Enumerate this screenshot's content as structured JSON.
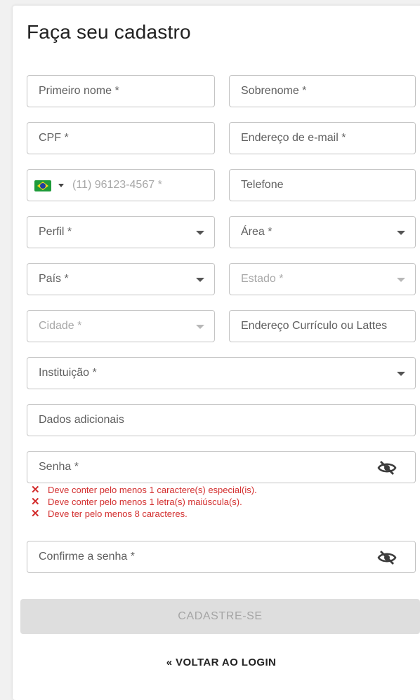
{
  "form": {
    "title": "Faça seu cadastro",
    "fields": {
      "first_name": "Primeiro nome *",
      "last_name": "Sobrenome *",
      "cpf": "CPF *",
      "email": "Endereço de e-mail *",
      "mobile_placeholder": "(11) 96123-4567 *",
      "phone": "Telefone",
      "profile": "Perfil *",
      "area": "Área *",
      "country": "País *",
      "state": "Estado *",
      "city": "Cidade *",
      "curriculum": "Endereço Currículo ou Lattes",
      "institution": "Instituição *",
      "additional": "Dados adicionais",
      "password": "Senha *",
      "confirm_password": "Confirme a senha *"
    },
    "password_errors": [
      "Deve conter pelo menos 1 caractere(s) especial(is).",
      "Deve conter pelo menos 1 letra(s) maiúscula(s).",
      "Deve ter pelo menos 8 caracteres."
    ],
    "submit_label": "CADASTRE-SE",
    "back_label": "« VOLTAR AO LOGIN"
  },
  "icons": {
    "country_flag": "brazil-flag-icon",
    "password_toggle": "eye-slash-icon",
    "error": "x-icon"
  },
  "colors": {
    "error": "#d32f2f",
    "border": "#c4c4c4",
    "button_disabled_bg": "#dedede"
  }
}
